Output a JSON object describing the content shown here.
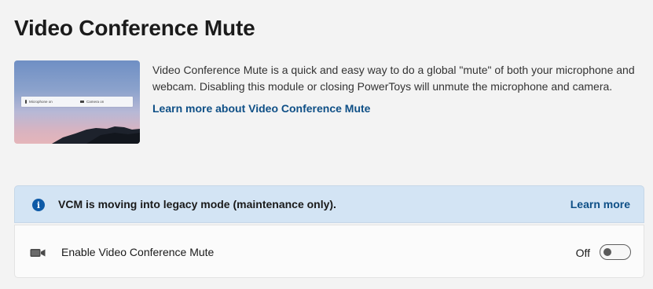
{
  "page": {
    "title": "Video Conference Mute"
  },
  "hero": {
    "mic_label": "Microphone on",
    "camera_label": "Camera on"
  },
  "description": {
    "text": "Video Conference Mute is a quick and easy way to do a global \"mute\" of both your microphone and webcam. Disabling this module or closing PowerToys will unmute the microphone and camera.",
    "link_label": "Learn more about Video Conference Mute"
  },
  "infobar": {
    "icon": "info-icon",
    "message": "VCM is moving into legacy mode (maintenance only).",
    "link_label": "Learn more"
  },
  "setting": {
    "icon": "video-camera-icon",
    "label": "Enable Video Conference Mute",
    "state_label": "Off",
    "enabled": false
  },
  "colors": {
    "accent": "#0e4f86",
    "info_background": "#d3e4f4",
    "page_background": "#f3f3f3"
  }
}
